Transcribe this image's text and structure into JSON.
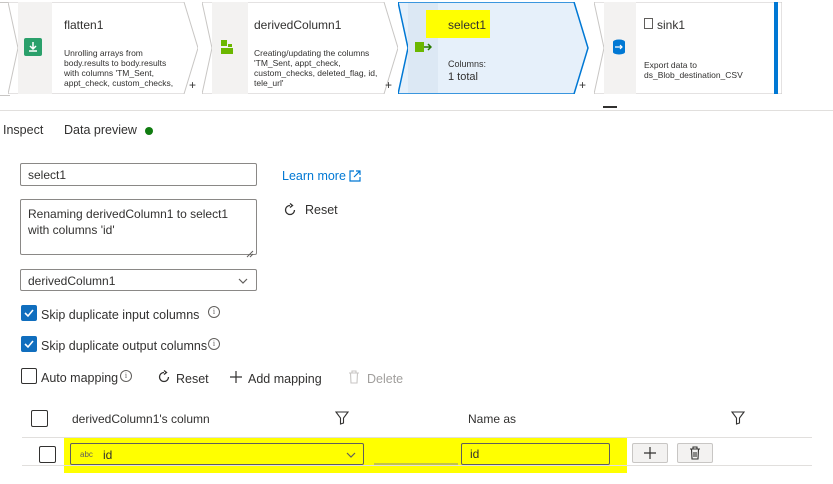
{
  "pipeline": {
    "nodes": [
      {
        "title": "flatten1",
        "desc": "Unrolling arrays from body.results to body.results with columns 'TM_Sent, appt_check, custom_checks, deleted_flag, id, tele_url'"
      },
      {
        "title": "derivedColumn1",
        "desc": "Creating/updating the columns 'TM_Sent, appt_check, custom_checks, deleted_flag, id, tele_url'"
      },
      {
        "title": "select1",
        "columns_label": "Columns:",
        "columns_value": "1 total"
      },
      {
        "title": "sink1",
        "desc": "Export data to ds_Blob_destination_CSV"
      }
    ],
    "plus": "+"
  },
  "tabs": {
    "inspect": "Inspect",
    "data_preview": "Data preview"
  },
  "form": {
    "name_value": "select1",
    "description_value": "Renaming derivedColumn1 to select1 with columns 'id'",
    "stream_value": "derivedColumn1",
    "learn_more": "Learn more",
    "reset_top": "Reset",
    "skip_dup_input": "Skip duplicate input columns",
    "skip_dup_output": "Skip duplicate output columns",
    "auto_mapping": "Auto mapping",
    "reset": "Reset",
    "add_mapping": "Add mapping",
    "delete": "Delete"
  },
  "mapping_table": {
    "headers": {
      "column": "derivedColumn1's column",
      "name_as": "Name as"
    },
    "rows": [
      {
        "type_badge": "abc",
        "source": "id",
        "target": "id"
      }
    ]
  },
  "colors": {
    "accent": "#0078d4",
    "highlight": "#ffff00",
    "status_green": "#107c10"
  }
}
